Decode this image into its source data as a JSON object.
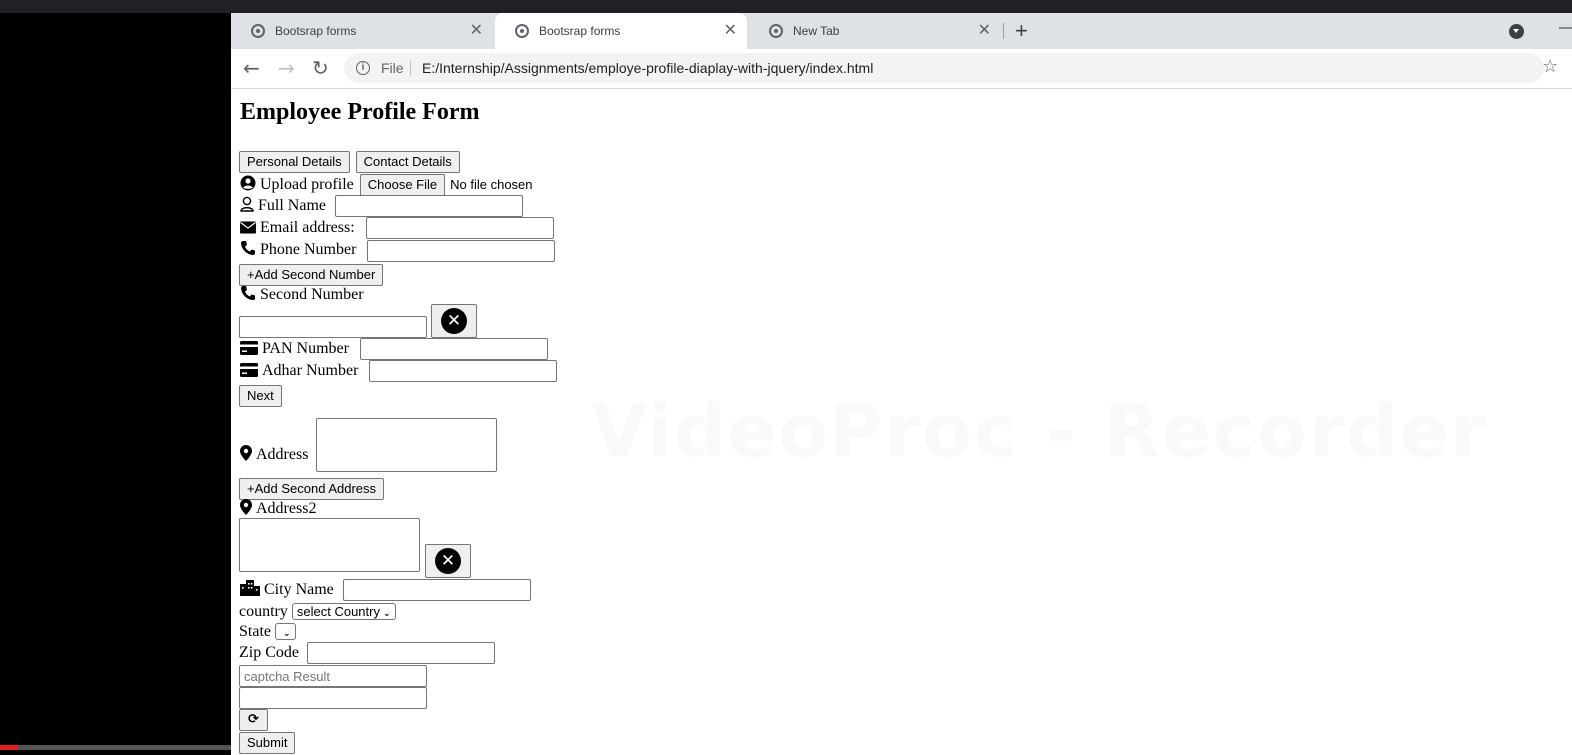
{
  "browser": {
    "tabs": [
      {
        "title": "Bootsrap forms",
        "close": "✕",
        "active": false
      },
      {
        "title": "Bootsrap forms",
        "close": "✕",
        "active": true
      },
      {
        "title": "New Tab",
        "close": "✕",
        "active": false
      }
    ],
    "new_tab": "+",
    "minimize": "—",
    "nav": {
      "back": "←",
      "forward": "→",
      "reload": "↻"
    },
    "omnibox": {
      "scheme": "File",
      "url": "E:/Internship/Assignments/employe-profile-diaplay-with-jquery/index.html",
      "bookmark": "☆",
      "info": "i"
    }
  },
  "form": {
    "title": "Employee Profile Form",
    "tabs": {
      "personal": "Personal Details",
      "contact": "Contact Details"
    },
    "upload": {
      "label": "Upload profile",
      "button": "Choose File",
      "status": "No file chosen"
    },
    "full_name": {
      "label": "Full Name",
      "value": ""
    },
    "email": {
      "label": "Email address:",
      "value": ""
    },
    "phone": {
      "label": "Phone Number",
      "value": ""
    },
    "add_second_number": "+Add Second Number",
    "second_number": {
      "label": "Second Number",
      "value": "",
      "remove": "✕"
    },
    "pan": {
      "label": "PAN Number",
      "value": ""
    },
    "adhar": {
      "label": "Adhar Number",
      "value": ""
    },
    "next": "Next",
    "address": {
      "label": "Address"
    },
    "add_second_address": "+Add Second Address",
    "address2": {
      "label": "Address2",
      "remove": "✕"
    },
    "city": {
      "label": "City Name",
      "value": ""
    },
    "country": {
      "label": "country",
      "selected": "select Country"
    },
    "state": {
      "label": "State",
      "selected": ""
    },
    "zip": {
      "label": "Zip Code",
      "value": ""
    },
    "captcha": {
      "placeholder": "captcha Result",
      "value": "",
      "refresh": "⟳"
    },
    "submit": "Submit"
  },
  "watermark": "VideoProc - Recorder",
  "video_progress": 0.08
}
